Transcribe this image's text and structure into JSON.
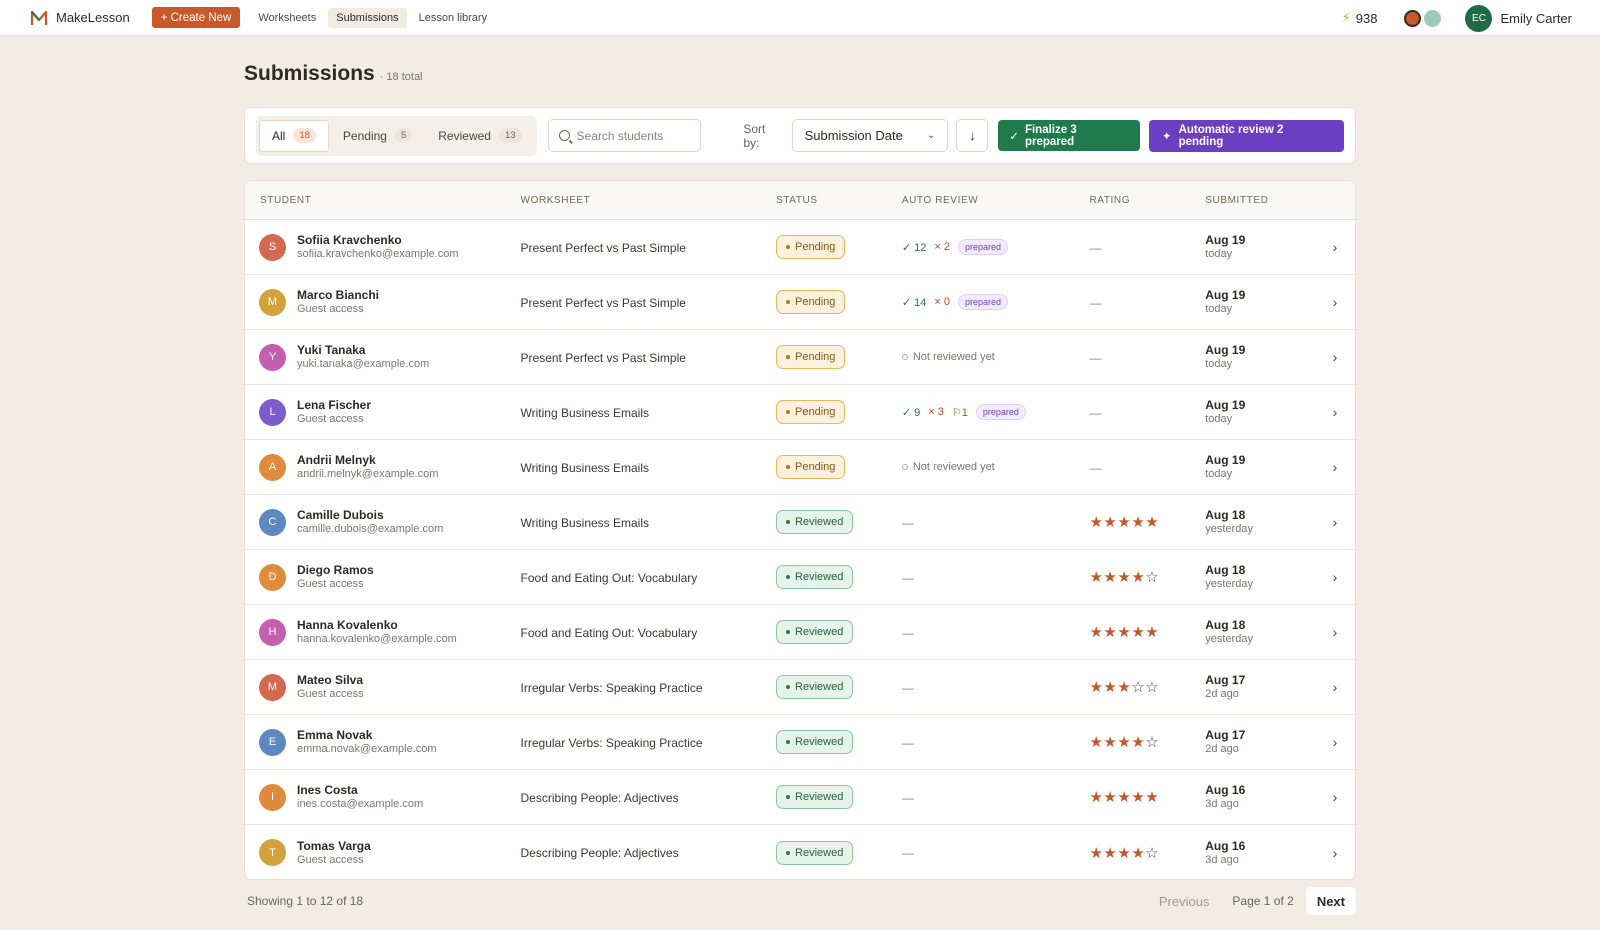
{
  "app": {
    "brand": "MakeLesson",
    "create_label": "+ Create New",
    "nav": [
      {
        "label": "Worksheets",
        "active": false
      },
      {
        "label": "Submissions",
        "active": true
      },
      {
        "label": "Lesson library",
        "active": false
      }
    ],
    "credits": "938",
    "user_initials": "EC",
    "user_name": "Emily Carter"
  },
  "page": {
    "title": "Submissions",
    "count_text": "· 18 total"
  },
  "filters": {
    "tabs": [
      {
        "label": "All",
        "count": "18",
        "active": true
      },
      {
        "label": "Pending",
        "count": "5",
        "active": false
      },
      {
        "label": "Reviewed",
        "count": "13",
        "active": false
      }
    ],
    "search_placeholder": "Search students",
    "sort_label": "Sort by:",
    "sort_value": "Submission Date",
    "finalize_label": "Finalize 3 prepared",
    "auto_review_label": "Automatic review 2 pending"
  },
  "table": {
    "headers": {
      "student": "STUDENT",
      "worksheet": "WORKSHEET",
      "status": "STATUS",
      "auto_review": "AUTO REVIEW",
      "rating": "RATING",
      "submitted": "SUBMITTED"
    },
    "rows": [
      {
        "initial": "S",
        "color": "#d3694f",
        "name": "Sofiia Kravchenko",
        "sub": "sofiia.kravchenko@example.com",
        "worksheet": "Present Perfect vs Past Simple",
        "status": "Pending",
        "auto": {
          "type": "prepared",
          "ok": "12",
          "bad": "2",
          "flag": null,
          "tag": "prepared"
        },
        "rating": null,
        "date": "Aug 19",
        "rel": "today"
      },
      {
        "initial": "M",
        "color": "#d3a23a",
        "name": "Marco Bianchi",
        "sub": "Guest access",
        "worksheet": "Present Perfect vs Past Simple",
        "status": "Pending",
        "auto": {
          "type": "prepared",
          "ok": "14",
          "bad": "0",
          "flag": null,
          "tag": "prepared"
        },
        "rating": null,
        "date": "Aug 19",
        "rel": "today"
      },
      {
        "initial": "Y",
        "color": "#c45fae",
        "name": "Yuki Tanaka",
        "sub": "yuki.tanaka@example.com",
        "worksheet": "Present Perfect vs Past Simple",
        "status": "Pending",
        "auto": {
          "type": "none",
          "text": "Not reviewed yet"
        },
        "rating": null,
        "date": "Aug 19",
        "rel": "today"
      },
      {
        "initial": "L",
        "color": "#7a5ccd",
        "name": "Lena Fischer",
        "sub": "Guest access",
        "worksheet": "Writing Business Emails",
        "status": "Pending",
        "auto": {
          "type": "prepared",
          "ok": "9",
          "bad": "3",
          "flag": "1",
          "tag": "prepared"
        },
        "rating": null,
        "date": "Aug 19",
        "rel": "today"
      },
      {
        "initial": "A",
        "color": "#df8b3c",
        "name": "Andrii Melnyk",
        "sub": "andrii.melnyk@example.com",
        "worksheet": "Writing Business Emails",
        "status": "Pending",
        "auto": {
          "type": "none",
          "text": "Not reviewed yet"
        },
        "rating": null,
        "date": "Aug 19",
        "rel": "today"
      },
      {
        "initial": "C",
        "color": "#5e89c0",
        "name": "Camille Dubois",
        "sub": "camille.dubois@example.com",
        "worksheet": "Writing Business Emails",
        "status": "Reviewed",
        "auto": {
          "type": "dash"
        },
        "rating": 5,
        "date": "Aug 18",
        "rel": "yesterday"
      },
      {
        "initial": "D",
        "color": "#df8b3c",
        "name": "Diego Ramos",
        "sub": "Guest access",
        "worksheet": "Food and Eating Out: Vocabulary",
        "status": "Reviewed",
        "auto": {
          "type": "dash"
        },
        "rating": 4,
        "date": "Aug 18",
        "rel": "yesterday"
      },
      {
        "initial": "H",
        "color": "#c45fae",
        "name": "Hanna Kovalenko",
        "sub": "hanna.kovalenko@example.com",
        "worksheet": "Food and Eating Out: Vocabulary",
        "status": "Reviewed",
        "auto": {
          "type": "dash"
        },
        "rating": 5,
        "date": "Aug 18",
        "rel": "yesterday"
      },
      {
        "initial": "M",
        "color": "#d3694f",
        "name": "Mateo Silva",
        "sub": "Guest access",
        "worksheet": "Irregular Verbs: Speaking Practice",
        "status": "Reviewed",
        "auto": {
          "type": "dash"
        },
        "rating": 3,
        "date": "Aug 17",
        "rel": "2d ago"
      },
      {
        "initial": "E",
        "color": "#5e89c0",
        "name": "Emma Novak",
        "sub": "emma.novak@example.com",
        "worksheet": "Irregular Verbs: Speaking Practice",
        "status": "Reviewed",
        "auto": {
          "type": "dash"
        },
        "rating": 4,
        "date": "Aug 17",
        "rel": "2d ago"
      },
      {
        "initial": "I",
        "color": "#df8b3c",
        "name": "Ines Costa",
        "sub": "ines.costa@example.com",
        "worksheet": "Describing People: Adjectives",
        "status": "Reviewed",
        "auto": {
          "type": "dash"
        },
        "rating": 5,
        "date": "Aug 16",
        "rel": "3d ago"
      },
      {
        "initial": "T",
        "color": "#d3a23a",
        "name": "Tomas Varga",
        "sub": "Guest access",
        "worksheet": "Describing People: Adjectives",
        "status": "Reviewed",
        "auto": {
          "type": "dash"
        },
        "rating": 4,
        "date": "Aug 16",
        "rel": "3d ago"
      }
    ]
  },
  "footer": {
    "showing": "Showing 1 to 12 of 18",
    "previous": "Previous",
    "page_info": "Page 1 of 2",
    "next": "Next"
  }
}
